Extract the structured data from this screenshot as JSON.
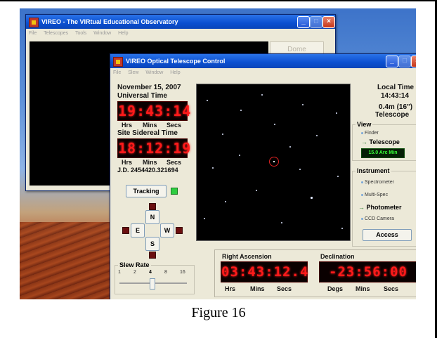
{
  "main_window": {
    "title": "VIREO - The VIRtual Educational Observatory",
    "menu": [
      "File",
      "Telescopes",
      "Tools",
      "Window",
      "Help"
    ],
    "dome_button": "Dome"
  },
  "telescope_window": {
    "title": "VIREO Optical Telescope Control",
    "menu": [
      "File",
      "Slew",
      "Window",
      "Help"
    ],
    "date": "November 15, 2007",
    "universal_time_label": "Universal Time",
    "universal_time": "19:43:14",
    "sidereal_label": "Site Sidereal Time",
    "sidereal_time": "18:12:19",
    "unit_hrs": "Hrs",
    "unit_mins": "Mins",
    "unit_secs": "Secs",
    "unit_degs": "Degs",
    "julian_date": "J.D. 2454420.321694",
    "tracking_button": "Tracking",
    "dir_n": "N",
    "dir_s": "S",
    "dir_e": "E",
    "dir_w": "W",
    "slew_rate_label": "Slew Rate",
    "slew_rates": [
      "1",
      "2",
      "4",
      "8",
      "16"
    ],
    "slew_rate_selected": "4",
    "local_time_label": "Local Time",
    "local_time": "14:43:14",
    "telescope_size": "0.4m (16\")",
    "telescope_label": "Telescope",
    "view_group": "View",
    "view_finder": "Finder",
    "view_telescope": "Telescope",
    "view_fov": "15.0 Arc Min",
    "instrument_group": "Instrument",
    "inst_spectrometer": "Spectrometer",
    "inst_multispec": "Multi-Spec",
    "inst_photometer": "Photometer",
    "inst_ccd": "CCD Camera",
    "access_button": "Access",
    "ra_label": "Right Ascension",
    "ra_value": "03:43:12.4",
    "dec_label": "Declination",
    "dec_value": "-23:56:00"
  },
  "caption": "Figure 16"
}
